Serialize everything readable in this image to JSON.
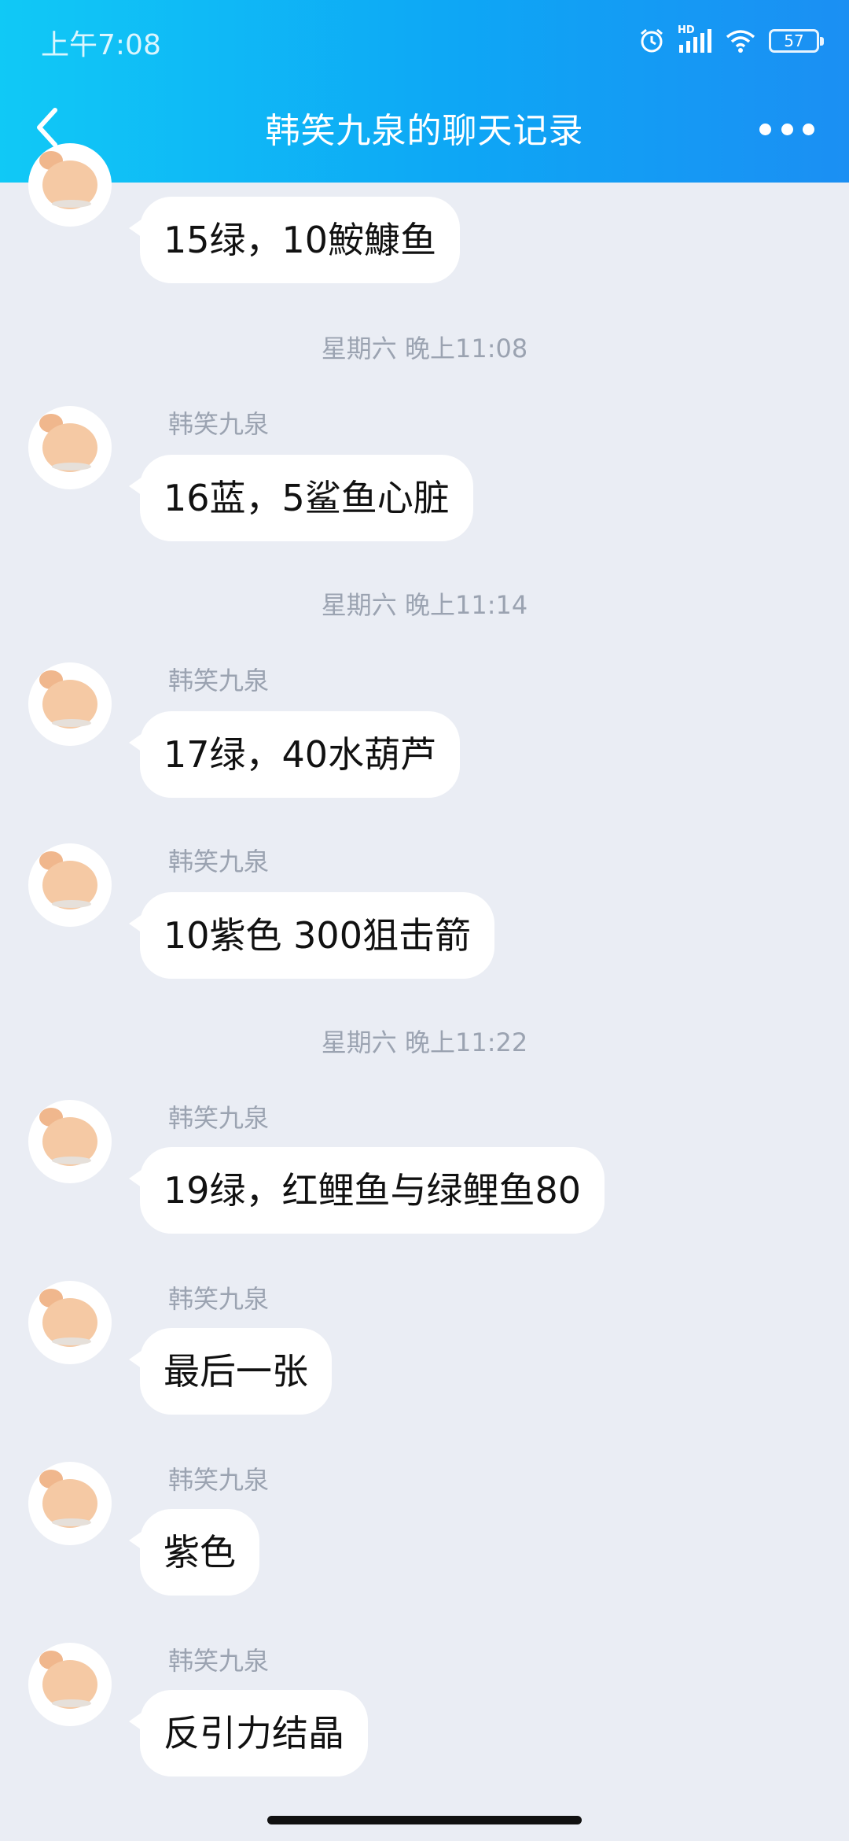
{
  "status_bar": {
    "time": "上午7:08",
    "battery": "57",
    "hd_label": "HD"
  },
  "header": {
    "title": "韩笑九泉的聊天记录"
  },
  "messages": [
    {
      "type": "message",
      "sender": "",
      "text": "15绿，10鮟鱇鱼"
    },
    {
      "type": "time",
      "text": "星期六 晚上11:08"
    },
    {
      "type": "message",
      "sender": "韩笑九泉",
      "text": "16蓝，5鲨鱼心脏"
    },
    {
      "type": "time",
      "text": "星期六 晚上11:14"
    },
    {
      "type": "message",
      "sender": "韩笑九泉",
      "text": "17绿，40水葫芦"
    },
    {
      "type": "message",
      "sender": "韩笑九泉",
      "text": "10紫色 300狙击箭"
    },
    {
      "type": "time",
      "text": "星期六 晚上11:22"
    },
    {
      "type": "message",
      "sender": "韩笑九泉",
      "text": "19绿，红鲤鱼与绿鲤鱼80"
    },
    {
      "type": "message",
      "sender": "韩笑九泉",
      "text": "最后一张"
    },
    {
      "type": "message",
      "sender": "韩笑九泉",
      "text": "紫色"
    },
    {
      "type": "message",
      "sender": "韩笑九泉",
      "text": "反引力结晶"
    }
  ],
  "colors": {
    "header_gradient_start": "#10c9f6",
    "header_gradient_end": "#1b8ff3",
    "background": "#eaedf4",
    "bubble": "#ffffff",
    "meta_text": "#9ba3b1"
  }
}
